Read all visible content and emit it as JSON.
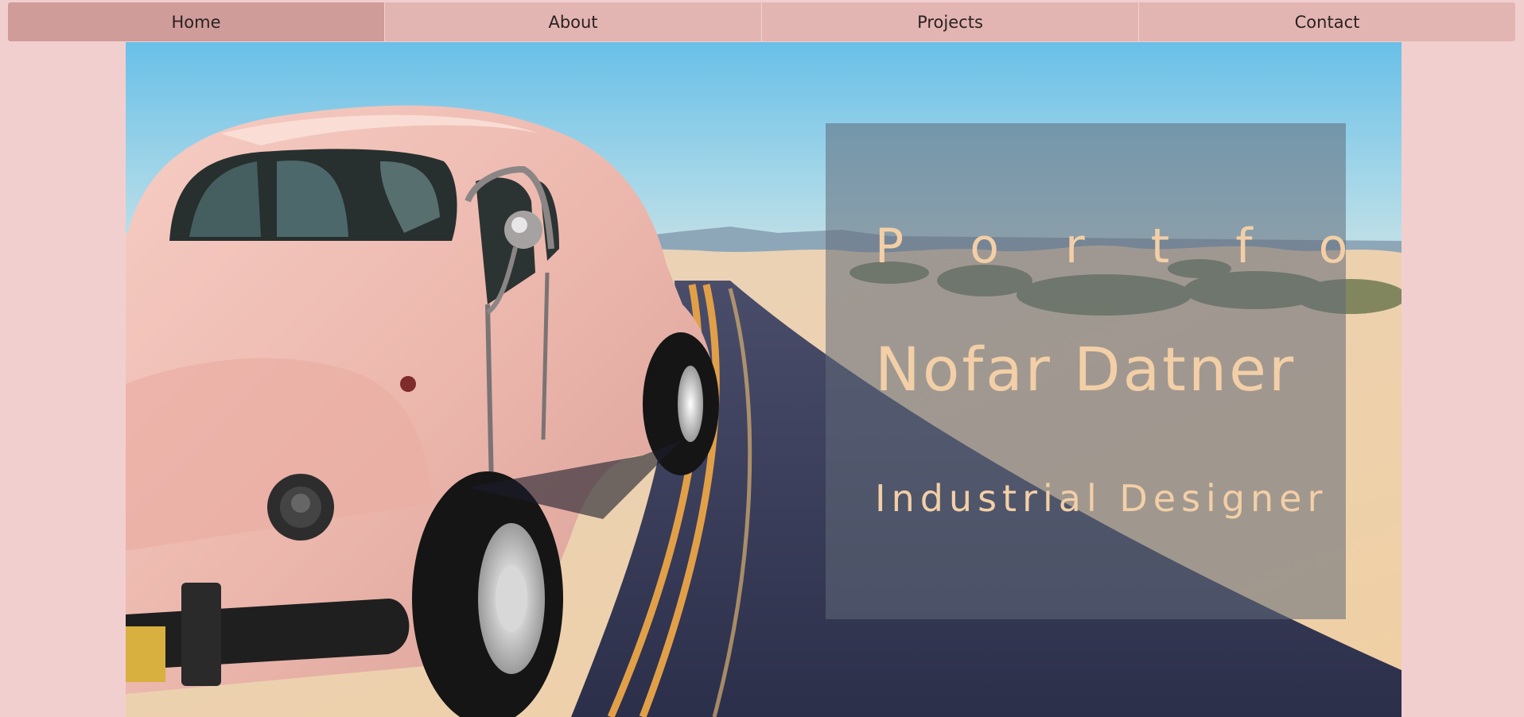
{
  "nav": {
    "items": [
      {
        "label": "Home",
        "active": true
      },
      {
        "label": "About",
        "active": false
      },
      {
        "label": "Projects",
        "active": false
      },
      {
        "label": "Contact",
        "active": false
      }
    ]
  },
  "hero": {
    "kicker": "P o r t f o l i o",
    "name": "Nofar Datner",
    "role": "Industrial Designer",
    "image": "pink-vintage-beetle-on-desert-road"
  },
  "colors": {
    "page_bg": "#f2cfcf",
    "nav_bg": "#e3b5b2",
    "nav_active": "#cf9c99",
    "title_text": "#f3cfa7",
    "overlay": "rgba(96,106,120,0.55)"
  }
}
